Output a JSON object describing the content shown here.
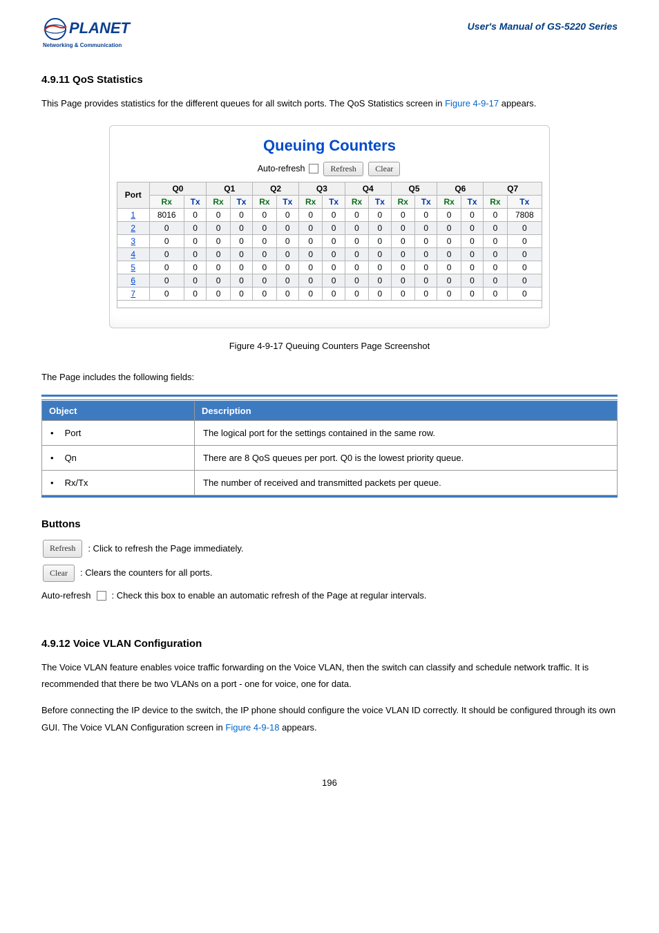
{
  "header": {
    "manual_title": "User's Manual of GS-5220 Series",
    "logo_alt": "PLANET Networking & Communication"
  },
  "section_1": {
    "title": "4.9.11 QoS Statistics",
    "intro_before_link": "This Page provides statistics for the different queues for all switch ports. The QoS Statistics screen in ",
    "intro_link": "Figure 4-9-17",
    "intro_after_link": " appears."
  },
  "figure": {
    "title": "Queuing Counters",
    "autorefresh_label": "Auto-refresh",
    "refresh_btn": "Refresh",
    "clear_btn": "Clear",
    "port_hdr": "Port",
    "q_headers": [
      "Q0",
      "Q1",
      "Q2",
      "Q3",
      "Q4",
      "Q5",
      "Q6",
      "Q7"
    ],
    "sub_headers": [
      "Rx",
      "Tx"
    ],
    "caption": "Figure 4-9-17 Queuing Counters Page Screenshot"
  },
  "chart_data": {
    "type": "table",
    "title": "Queuing Counters",
    "columns": [
      "Port",
      "Q0 Rx",
      "Q0 Tx",
      "Q1 Rx",
      "Q1 Tx",
      "Q2 Rx",
      "Q2 Tx",
      "Q3 Rx",
      "Q3 Tx",
      "Q4 Rx",
      "Q4 Tx",
      "Q5 Rx",
      "Q5 Tx",
      "Q6 Rx",
      "Q6 Tx",
      "Q7 Rx",
      "Q7 Tx"
    ],
    "rows": [
      {
        "port": "1",
        "vals": [
          8016,
          0,
          0,
          0,
          0,
          0,
          0,
          0,
          0,
          0,
          0,
          0,
          0,
          0,
          0,
          7808
        ]
      },
      {
        "port": "2",
        "vals": [
          0,
          0,
          0,
          0,
          0,
          0,
          0,
          0,
          0,
          0,
          0,
          0,
          0,
          0,
          0,
          0
        ]
      },
      {
        "port": "3",
        "vals": [
          0,
          0,
          0,
          0,
          0,
          0,
          0,
          0,
          0,
          0,
          0,
          0,
          0,
          0,
          0,
          0
        ]
      },
      {
        "port": "4",
        "vals": [
          0,
          0,
          0,
          0,
          0,
          0,
          0,
          0,
          0,
          0,
          0,
          0,
          0,
          0,
          0,
          0
        ]
      },
      {
        "port": "5",
        "vals": [
          0,
          0,
          0,
          0,
          0,
          0,
          0,
          0,
          0,
          0,
          0,
          0,
          0,
          0,
          0,
          0
        ]
      },
      {
        "port": "6",
        "vals": [
          0,
          0,
          0,
          0,
          0,
          0,
          0,
          0,
          0,
          0,
          0,
          0,
          0,
          0,
          0,
          0
        ]
      },
      {
        "port": "7",
        "vals": [
          0,
          0,
          0,
          0,
          0,
          0,
          0,
          0,
          0,
          0,
          0,
          0,
          0,
          0,
          0,
          0
        ]
      }
    ]
  },
  "fields": {
    "intro": "The Page includes the following fields:",
    "header_obj": "Object",
    "header_desc": "Description",
    "rows": [
      {
        "obj": "Port",
        "desc": "The logical port for the settings contained in the same row."
      },
      {
        "obj": "Qn",
        "desc": "There are 8 QoS queues per port. Q0 is the lowest priority queue."
      },
      {
        "obj": "Rx/Tx",
        "desc": "The number of received and transmitted packets per queue."
      }
    ]
  },
  "buttons": {
    "title": "Buttons",
    "refresh_label": "Refresh",
    "refresh_desc": ": Click to refresh the Page immediately.",
    "clear_label": "Clear",
    "clear_desc": ": Clears the counters for all ports.",
    "autorefresh_prefix": "Auto-refresh ",
    "autorefresh_desc": ": Check this box to enable an automatic refresh of the Page at regular intervals."
  },
  "section_2": {
    "title": "4.9.12 Voice VLAN Configuration",
    "p1": "The Voice VLAN feature enables voice traffic forwarding on the Voice VLAN, then the switch can classify and schedule network traffic. It is recommended that there be two VLANs on a port - one for voice, one for data.",
    "p2_before": "Before connecting the IP device to the switch, the IP phone should configure the voice VLAN ID correctly. It should be configured through its own GUI. The Voice VLAN Configuration screen in ",
    "p2_link": "Figure 4-9-18",
    "p2_after": " appears."
  },
  "page_number": "196"
}
